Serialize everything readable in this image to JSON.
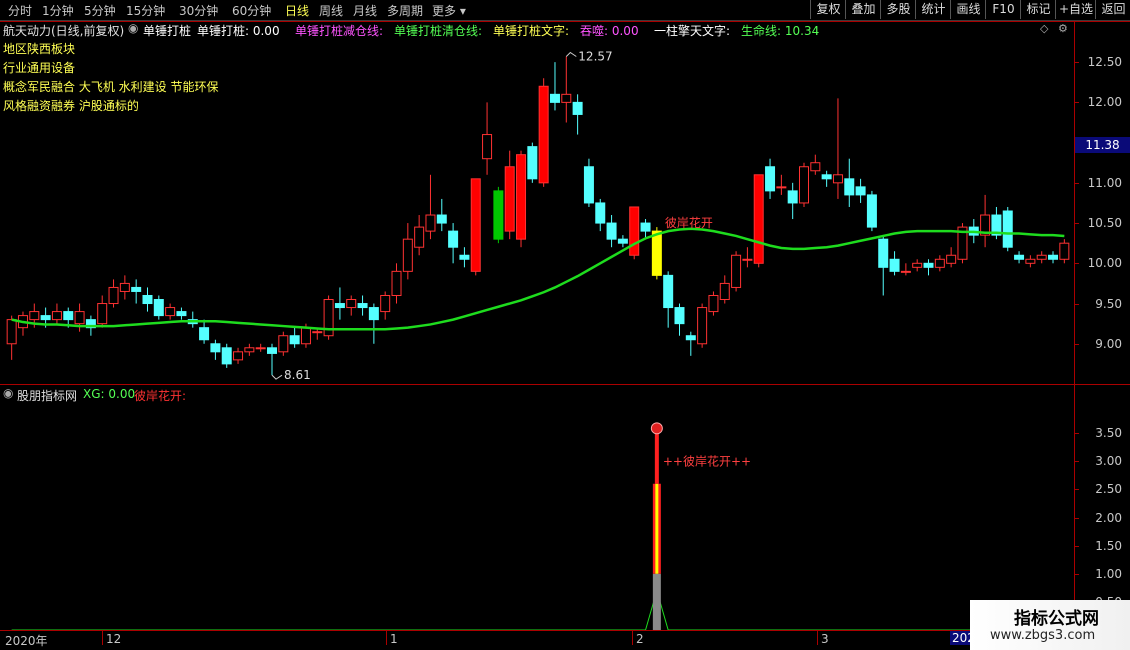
{
  "toolbar": {
    "tabs": [
      "分时",
      "1分钟",
      "5分钟",
      "15分钟",
      "30分钟",
      "60分钟",
      "日线",
      "周线",
      "月线",
      "多周期",
      "更多"
    ],
    "active_tab": "日线",
    "right_buttons": [
      "复权",
      "叠加",
      "多股",
      "统计",
      "画线",
      "F10",
      "标记",
      "+自选",
      "返回"
    ]
  },
  "main_panel": {
    "title": "航天动力(日线,前复权)",
    "indicator": "单锤打桩",
    "params": [
      {
        "label": "单锤打桩: 0.00",
        "color": "#ffffff"
      },
      {
        "label": "单锤打桩减仓线:",
        "color": "#ff54ff"
      },
      {
        "label": "单锤打桩清仓线:",
        "color": "#54ff54"
      },
      {
        "label": "单锤打桩文字:",
        "color": "#ffff54"
      },
      {
        "label": "吞噬: 0.00",
        "color": "#ff54ff"
      },
      {
        "label": "一柱擎天文字:",
        "color": "#ffffff"
      },
      {
        "label": "生命线: 10.34",
        "color": "#54ff54"
      }
    ],
    "info_lines": [
      "地区陕西板块",
      "行业通用设备",
      "概念军民融合 大飞机 水利建设 节能环保",
      "风格融资融券 沪股通标的"
    ],
    "high_label": "12.57",
    "low_label": "8.61",
    "signal_text": "彼岸花开",
    "current_price": "11.38",
    "price_ticks": [
      "12.50",
      "12.00",
      "11.50",
      "11.00",
      "10.50",
      "10.00",
      "9.50",
      "9.00"
    ]
  },
  "sub_panel": {
    "title": "股朋指标网",
    "xg_label": "XG: 0.00",
    "signal_label": "彼岸花开:",
    "signal_text": "++彼岸花开++",
    "ticks": [
      "3.50",
      "3.00",
      "2.50",
      "2.00",
      "1.50",
      "1.00",
      "0.50"
    ]
  },
  "date_axis": [
    "2020年",
    "12",
    "1",
    "2",
    "3",
    "202"
  ],
  "watermark": {
    "title": "指标公式网",
    "url": "www.zbgs3.com"
  },
  "colors": {
    "up": "#ff3232",
    "down": "#54ffff",
    "lifeline": "#1edc1e",
    "axis": "#aa0000",
    "yellow": "#ffff00",
    "green": "#00c800"
  },
  "chart_data": {
    "type": "candlestick",
    "ylim": [
      8.5,
      12.8
    ],
    "candles": [
      [
        9.0,
        9.3,
        8.8,
        9.35
      ],
      [
        9.2,
        9.35,
        9.1,
        9.4
      ],
      [
        9.3,
        9.4,
        9.2,
        9.5
      ],
      [
        9.35,
        9.3,
        9.2,
        9.45
      ],
      [
        9.3,
        9.4,
        9.25,
        9.5
      ],
      [
        9.4,
        9.3,
        9.2,
        9.45
      ],
      [
        9.25,
        9.4,
        9.15,
        9.5
      ],
      [
        9.3,
        9.2,
        9.1,
        9.35
      ],
      [
        9.25,
        9.5,
        9.2,
        9.6
      ],
      [
        9.5,
        9.7,
        9.45,
        9.8
      ],
      [
        9.65,
        9.75,
        9.55,
        9.85
      ],
      [
        9.7,
        9.65,
        9.5,
        9.8
      ],
      [
        9.6,
        9.5,
        9.4,
        9.7
      ],
      [
        9.55,
        9.35,
        9.3,
        9.6
      ],
      [
        9.35,
        9.45,
        9.3,
        9.5
      ],
      [
        9.4,
        9.35,
        9.3,
        9.45
      ],
      [
        9.3,
        9.25,
        9.2,
        9.4
      ],
      [
        9.2,
        9.05,
        9.0,
        9.3
      ],
      [
        9.0,
        8.9,
        8.8,
        9.05
      ],
      [
        8.95,
        8.75,
        8.7,
        9.0
      ],
      [
        8.8,
        8.9,
        8.75,
        8.95
      ],
      [
        8.9,
        8.95,
        8.85,
        9.0
      ],
      [
        8.95,
        8.95,
        8.9,
        9.0
      ],
      [
        8.95,
        8.88,
        8.61,
        9.0
      ],
      [
        8.9,
        9.1,
        8.85,
        9.15
      ],
      [
        9.1,
        9.0,
        8.95,
        9.2
      ],
      [
        9.0,
        9.2,
        8.95,
        9.25
      ],
      [
        9.15,
        9.15,
        9.05,
        9.2
      ],
      [
        9.1,
        9.55,
        9.05,
        9.6
      ],
      [
        9.5,
        9.45,
        9.3,
        9.7
      ],
      [
        9.45,
        9.55,
        9.35,
        9.6
      ],
      [
        9.5,
        9.45,
        9.35,
        9.6
      ],
      [
        9.45,
        9.3,
        9.0,
        9.5
      ],
      [
        9.4,
        9.6,
        9.3,
        9.65
      ],
      [
        9.6,
        9.9,
        9.5,
        10.0
      ],
      [
        9.9,
        10.3,
        9.8,
        10.5
      ],
      [
        10.2,
        10.45,
        10.1,
        10.6
      ],
      [
        10.4,
        10.6,
        10.3,
        11.1
      ],
      [
        10.6,
        10.5,
        10.4,
        10.8
      ],
      [
        10.4,
        10.2,
        10.0,
        10.5
      ],
      [
        10.1,
        10.05,
        9.95,
        10.2
      ],
      [
        9.9,
        11.05,
        9.85,
        11.05
      ],
      [
        11.3,
        11.6,
        11.1,
        12.0
      ],
      [
        10.3,
        10.9,
        10.25,
        10.95
      ],
      [
        10.4,
        11.2,
        10.3,
        11.4
      ],
      [
        10.3,
        11.35,
        10.2,
        11.4
      ],
      [
        11.45,
        11.05,
        11.0,
        11.5
      ],
      [
        11.0,
        12.2,
        10.95,
        12.3
      ],
      [
        12.1,
        12.0,
        11.9,
        12.5
      ],
      [
        12.0,
        12.1,
        11.75,
        12.57
      ],
      [
        12.0,
        11.85,
        11.6,
        12.1
      ],
      [
        11.2,
        10.75,
        10.7,
        11.3
      ],
      [
        10.75,
        10.5,
        10.4,
        10.8
      ],
      [
        10.5,
        10.3,
        10.2,
        10.6
      ],
      [
        10.3,
        10.25,
        10.2,
        10.35
      ],
      [
        10.1,
        10.7,
        10.05,
        10.7
      ],
      [
        10.5,
        10.4,
        10.3,
        10.55
      ],
      [
        10.4,
        9.85,
        9.8,
        10.45
      ],
      [
        9.85,
        9.45,
        9.2,
        9.9
      ],
      [
        9.45,
        9.25,
        9.1,
        9.5
      ],
      [
        9.1,
        9.05,
        8.85,
        9.15
      ],
      [
        9.0,
        9.45,
        8.95,
        9.5
      ],
      [
        9.4,
        9.6,
        9.35,
        9.65
      ],
      [
        9.55,
        9.75,
        9.5,
        9.85
      ],
      [
        9.7,
        10.1,
        9.65,
        10.15
      ],
      [
        10.05,
        10.05,
        9.95,
        10.2
      ],
      [
        10.0,
        11.1,
        9.95,
        11.1
      ],
      [
        11.2,
        10.9,
        10.8,
        11.3
      ],
      [
        10.95,
        10.95,
        10.85,
        11.1
      ],
      [
        10.9,
        10.75,
        10.55,
        11.0
      ],
      [
        10.75,
        11.2,
        10.7,
        11.25
      ],
      [
        11.15,
        11.25,
        11.1,
        11.35
      ],
      [
        11.1,
        11.05,
        10.95,
        11.15
      ],
      [
        11.0,
        11.1,
        10.8,
        12.05
      ],
      [
        11.05,
        10.85,
        10.7,
        11.3
      ],
      [
        10.95,
        10.85,
        10.75,
        11.05
      ],
      [
        10.85,
        10.45,
        10.4,
        10.9
      ],
      [
        10.3,
        9.95,
        9.6,
        10.35
      ],
      [
        10.05,
        9.9,
        9.85,
        10.15
      ],
      [
        9.9,
        9.9,
        9.85,
        10.0
      ],
      [
        9.95,
        10.0,
        9.9,
        10.05
      ],
      [
        10.0,
        9.95,
        9.85,
        10.05
      ],
      [
        9.95,
        10.05,
        9.9,
        10.1
      ],
      [
        10.0,
        10.1,
        9.95,
        10.2
      ],
      [
        10.05,
        10.45,
        10.0,
        10.5
      ],
      [
        10.45,
        10.35,
        10.25,
        10.55
      ],
      [
        10.35,
        10.6,
        10.2,
        10.85
      ],
      [
        10.6,
        10.35,
        10.3,
        10.7
      ],
      [
        10.65,
        10.2,
        10.15,
        10.7
      ],
      [
        10.1,
        10.05,
        10.0,
        10.15
      ],
      [
        10.0,
        10.05,
        9.95,
        10.1
      ],
      [
        10.05,
        10.1,
        10.0,
        10.15
      ],
      [
        10.1,
        10.05,
        10.0,
        10.15
      ],
      [
        10.05,
        10.25,
        10.0,
        10.3
      ]
    ],
    "lifeline": [
      9.3,
      9.27,
      9.25,
      9.24,
      9.24,
      9.23,
      9.22,
      9.22,
      9.22,
      9.22,
      9.23,
      9.24,
      9.25,
      9.26,
      9.27,
      9.28,
      9.28,
      9.28,
      9.28,
      9.27,
      9.26,
      9.25,
      9.24,
      9.23,
      9.22,
      9.21,
      9.2,
      9.19,
      9.18,
      9.18,
      9.18,
      9.18,
      9.18,
      9.18,
      9.19,
      9.2,
      9.22,
      9.24,
      9.27,
      9.3,
      9.34,
      9.38,
      9.42,
      9.46,
      9.5,
      9.54,
      9.59,
      9.64,
      9.7,
      9.77,
      9.84,
      9.92,
      10.0,
      10.08,
      10.16,
      10.24,
      10.31,
      10.36,
      10.4,
      10.42,
      10.43,
      10.42,
      10.4,
      10.37,
      10.34,
      10.3,
      10.26,
      10.22,
      10.19,
      10.18,
      10.18,
      10.19,
      10.2,
      10.22,
      10.25,
      10.28,
      10.31,
      10.34,
      10.37,
      10.39,
      10.4,
      10.4,
      10.4,
      10.4,
      10.39,
      10.39,
      10.38,
      10.38,
      10.37,
      10.37,
      10.36,
      10.35,
      10.35,
      10.34
    ],
    "special": {
      "yellow_index": 57,
      "green_index": 43
    },
    "indicator": {
      "signal_value": 3.55,
      "bar_top": 2.6,
      "bar_gray_top": 1.0,
      "line_peak": 0.7
    }
  }
}
